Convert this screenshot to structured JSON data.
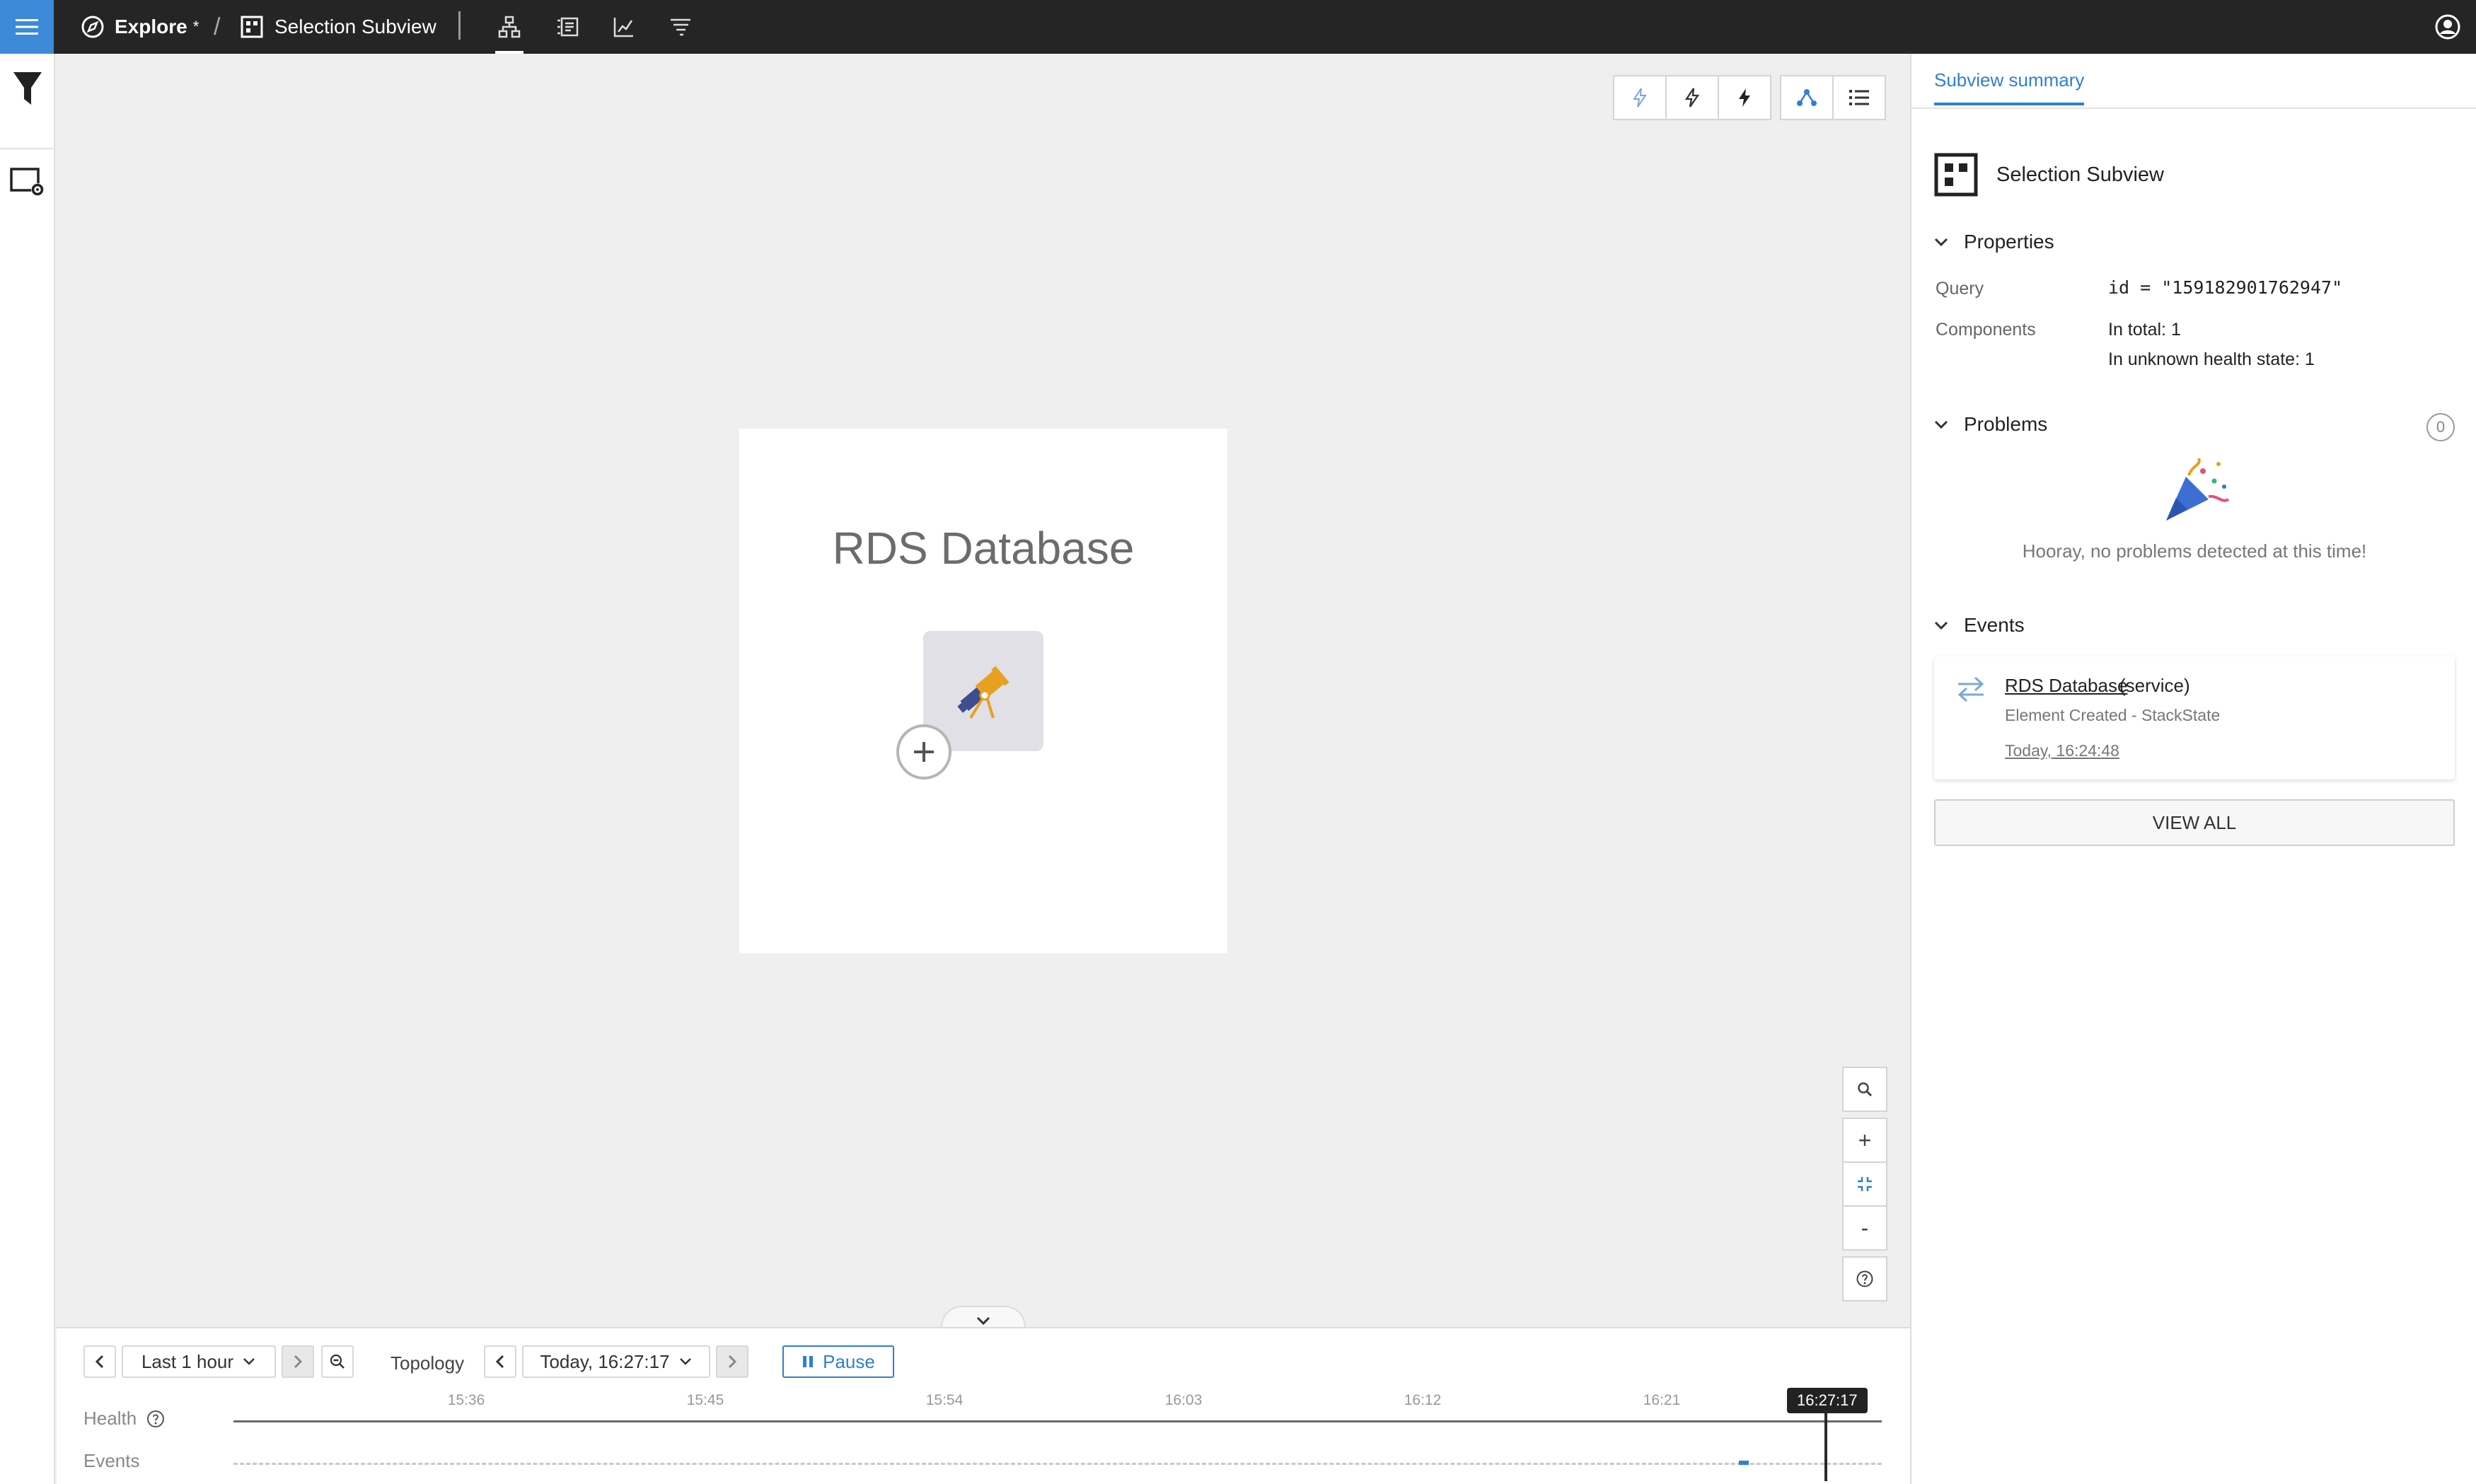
{
  "header": {
    "explore_label": "Explore",
    "explore_suffix": "*",
    "separator": "/",
    "subview_label": "Selection Subview",
    "view_icons": [
      "topology-view-icon",
      "events-view-icon",
      "metrics-view-icon",
      "traces-view-icon"
    ],
    "accent_color": "#3d8bd8"
  },
  "left_rail": {
    "icons": [
      "filter-icon",
      "view-settings-icon"
    ]
  },
  "canvas": {
    "overlay_icons": [
      "unknown-health-icon",
      "deviating-health-icon",
      "critical-health-icon",
      "topology-mode-icon",
      "list-mode-icon"
    ],
    "node": {
      "title": "RDS Database",
      "icon": "telescope-icon"
    },
    "zoom_controls": {
      "search": "search-icon",
      "zoom_in": "+",
      "fit": "fit-screen-icon",
      "zoom_out": "-",
      "help": "help-icon"
    }
  },
  "timeline": {
    "range_label": "Last 1 hour",
    "mode_label": "Topology",
    "time_label": "Today, 16:27:17",
    "pause_label": "Pause",
    "health_label": "Health",
    "events_label": "Events",
    "ticks": [
      "15:36",
      "15:45",
      "15:54",
      "16:03",
      "16:12",
      "16:21"
    ],
    "cursor_label": "16:27:17"
  },
  "summary": {
    "tab_label": "Subview summary",
    "title": "Selection Subview",
    "properties": {
      "heading": "Properties",
      "query_key": "Query",
      "query_value": "id = \"159182901762947\"",
      "components_key": "Components",
      "components_total": "In total: 1",
      "components_unknown": "In unknown health state: 1"
    },
    "problems": {
      "heading": "Problems",
      "count": "0",
      "empty_text": "Hooray, no problems detected at this time!"
    },
    "events": {
      "heading": "Events",
      "item": {
        "name": "RDS Database",
        "type": "(service)",
        "description": "Element Created  -  StackState",
        "time": "Today, 16:24:48"
      },
      "view_all_label": "VIEW ALL"
    }
  }
}
